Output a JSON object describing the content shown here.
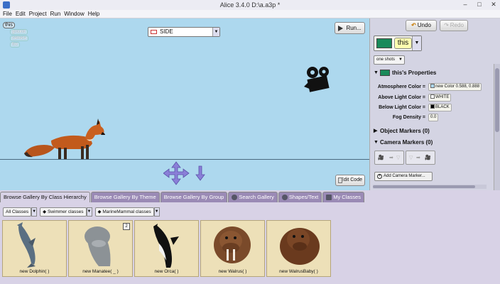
{
  "window": {
    "title": "Alice 3.4.0 D:\\a.a3p *",
    "buttons": [
      "–",
      "□",
      "✕"
    ]
  },
  "menu": [
    "File",
    "Edit",
    "Project",
    "Run",
    "Window",
    "Help"
  ],
  "scene": {
    "tree": {
      "root": "this",
      "children": [
        "ground",
        "camera",
        "fox"
      ]
    },
    "camera_view": "SIDE",
    "run_label": "Run...",
    "edit_code_label": "Edit Code"
  },
  "toolbar": {
    "undo": "Undo",
    "redo": "Redo"
  },
  "selected": {
    "label": "this",
    "swatch_color": "#1a8a5a"
  },
  "oneshots_label": "one shots",
  "properties": {
    "header": "this's Properties",
    "rows": [
      {
        "label": "Atmosphere Color =",
        "value": "new Color 0.588, 0.888"
      },
      {
        "label": "Above Light Color =",
        "value": "WHITE"
      },
      {
        "label": "Below Light Color =",
        "value": "BLACK"
      },
      {
        "label": "Fog Density =",
        "value": "0.0"
      }
    ]
  },
  "object_markers": "Object Markers (0)",
  "camera_markers": "Camera Markers (0)",
  "add_camera_marker": "Add Camera Marker...",
  "gallery": {
    "tabs": [
      "Browse Gallery By Class Hierarchy",
      "Browse Gallery By Theme",
      "Browse Gallery By Group",
      "Search Gallery",
      "Shapes/Text",
      "My Classes"
    ],
    "filters": [
      "All Classes",
      "Swimmer classes",
      "MarineMammal classes"
    ],
    "items": [
      {
        "name": "new Dolphin( )",
        "badge": ""
      },
      {
        "name": "new Manatee( _ )",
        "badge": "2"
      },
      {
        "name": "new Orca( )",
        "badge": ""
      },
      {
        "name": "new Walrus( )",
        "badge": ""
      },
      {
        "name": "new WalrusBaby( )",
        "badge": ""
      }
    ]
  }
}
